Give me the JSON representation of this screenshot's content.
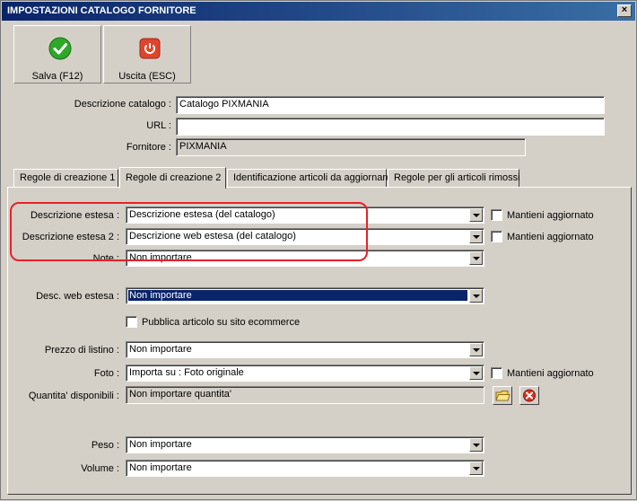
{
  "window": {
    "title": "IMPOSTAZIONI CATALOGO FORNITORE",
    "close": "×"
  },
  "toolbar": {
    "save_label": "Salva (F12)",
    "exit_label": "Uscita (ESC)"
  },
  "header": {
    "catalog_label": "Descrizione catalogo :",
    "catalog_value": "Catalogo PIXMANIA",
    "url_label": "URL :",
    "url_value": "",
    "supplier_label": "Fornitore :",
    "supplier_value": "PIXMANIA"
  },
  "tabs": [
    {
      "label": "Regole di creazione 1"
    },
    {
      "label": "Regole di creazione 2"
    },
    {
      "label": "Identificazione articoli da aggiornare"
    },
    {
      "label": "Regole per gli articoli rimossi"
    }
  ],
  "form": {
    "ext_desc_label": "Descrizione estesa :",
    "ext_desc_value": "Descrizione estesa (del catalogo)",
    "ext_desc2_label": "Descrizione estesa 2 :",
    "ext_desc2_value": "Descrizione web estesa (del catalogo)",
    "note_label": "Note :",
    "note_value": "Non importare",
    "web_desc_label": "Desc. web estesa :",
    "web_desc_value": "Non importare",
    "publish_label": "Pubblica articolo su sito ecommerce",
    "price_label": "Prezzo di listino :",
    "price_value": "Non importare",
    "photo_label": "Foto :",
    "photo_value": "Importa su : Foto originale",
    "qty_label": "Quantita' disponibili :",
    "qty_value": "Non importare quantita'",
    "weight_label": "Peso :",
    "weight_value": "Non importare",
    "volume_label": "Volume :",
    "volume_value": "Non importare",
    "keep_updated_label": "Mantieni aggiornato"
  },
  "colors": {
    "title_start": "#0a246a",
    "title_end": "#3a6ea5",
    "highlight": "#e8202a",
    "selection": "#0a246a"
  }
}
